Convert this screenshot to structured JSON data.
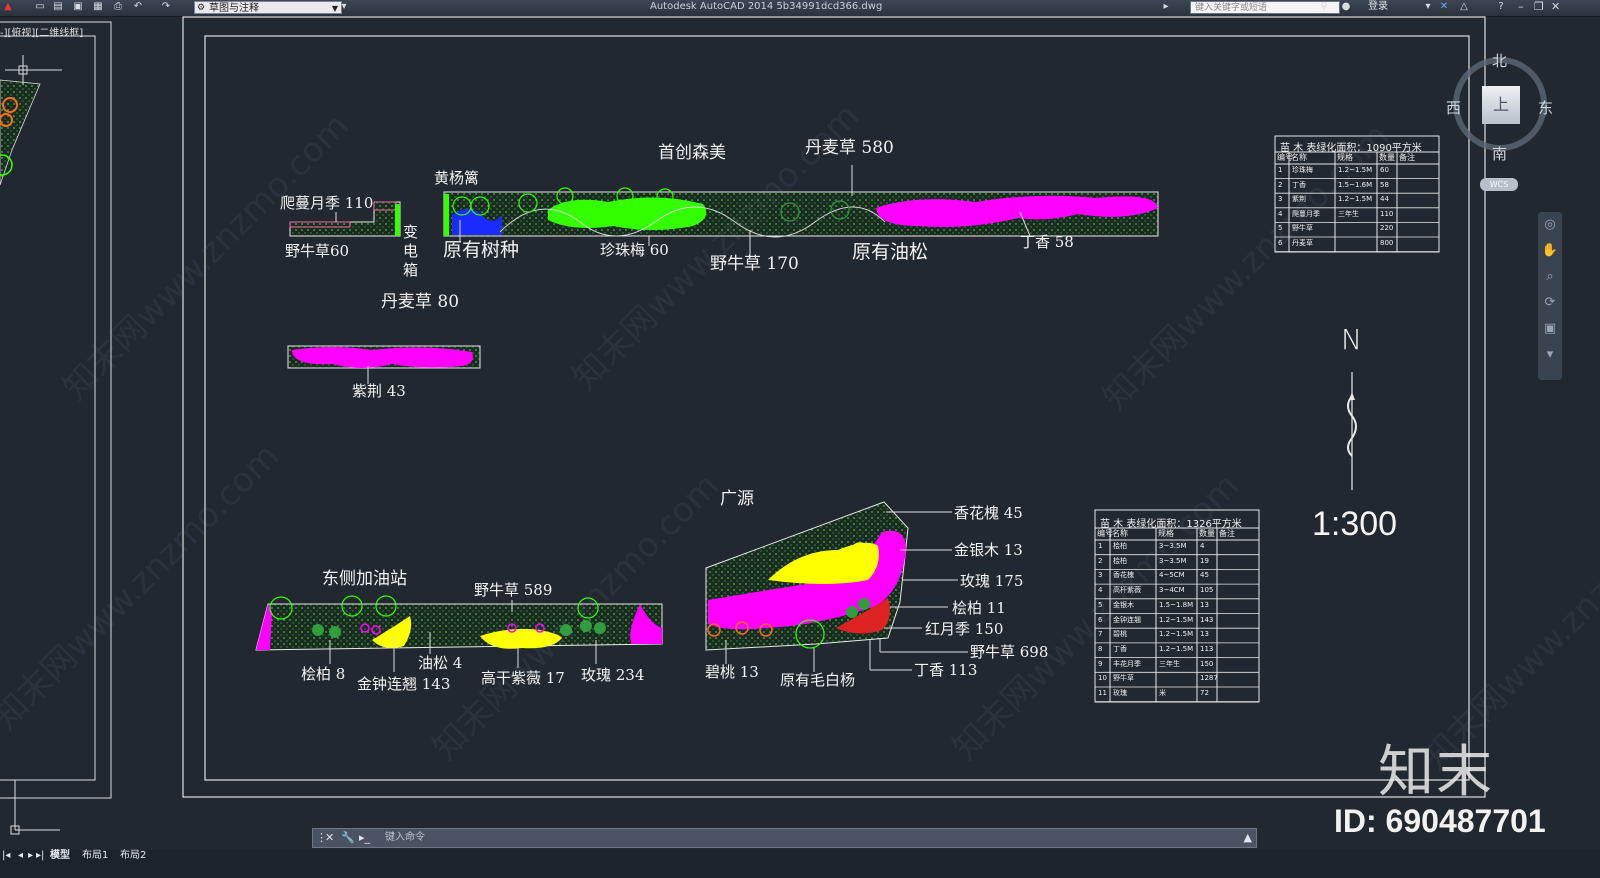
{
  "app": {
    "workspace": "草图与注释",
    "title": "Autodesk AutoCAD 2014    5b34991dcd366.dwg",
    "search_placeholder": "键入关键字或短语",
    "login": "登录"
  },
  "viewport": {
    "left_label": "-][俯视][二维线框]"
  },
  "viewcube": {
    "north": "北",
    "south": "南",
    "east": "东",
    "west": "西",
    "face": "上",
    "wcs": "WCS"
  },
  "drawing": {
    "north_arrow": "N",
    "scale": "1:300",
    "section1": {
      "title": "首创森美",
      "labels": {
        "pashan": "爬蔓月季  110",
        "yeniu60": "野牛草60",
        "biandian": "变电箱",
        "huangyang": "黄杨篱",
        "yuanyou_shuzhong": "原有树种",
        "zhenzhumei": "珍珠梅  60",
        "yeniu170": "野牛草  170",
        "yuanyou_yousong": "原有油松",
        "danmai580": "丹麦草  580",
        "dingxiang58": "丁香  58"
      }
    },
    "section2": {
      "danmai80": "丹麦草  80",
      "zijing43": "紫荆  43"
    },
    "section3": {
      "title": "东侧加油站",
      "labels": {
        "yeniu589": "野牛草  589",
        "guibai8": "桧柏  8",
        "jinzhong143": "金钟连翘  143",
        "yousong4": "油松  4",
        "gaogan17": "高干紫薇  17",
        "meigui234": "玫瑰  234"
      }
    },
    "section4": {
      "title": "广源",
      "labels": {
        "xianghuahuai45": "香花槐  45",
        "jinyinmu13": "金银木  13",
        "meigui175": "玫瑰  175",
        "guibai11": "桧柏  11",
        "hongyueji150": "红月季  150",
        "yeniu698": "野牛草  698",
        "dingxiang113": "丁香  113",
        "bitao13": "碧桃  13",
        "maobaiyang": "原有毛白杨"
      }
    },
    "table1": {
      "title": "苗  木  表绿化面积：1090平方米",
      "headers": [
        "编号",
        "名称",
        "规格",
        "数量",
        "备注"
      ],
      "rows": [
        [
          "1",
          "珍珠梅",
          "1.2~1.5M",
          "60",
          ""
        ],
        [
          "2",
          "丁香",
          "1.5~1.6M",
          "58",
          ""
        ],
        [
          "3",
          "紫荆",
          "1.2~1.5M",
          "44",
          ""
        ],
        [
          "4",
          "爬蔓月季",
          "三年生",
          "110",
          ""
        ],
        [
          "5",
          "野牛草",
          "",
          "220",
          ""
        ],
        [
          "6",
          "丹麦草",
          "",
          "800",
          ""
        ]
      ]
    },
    "table2": {
      "title": "苗  木  表绿化面积：1326平方米",
      "headers": [
        "编号",
        "名称",
        "规格",
        "数量",
        "备注"
      ],
      "rows": [
        [
          "1",
          "桧柏",
          "3~3.5M",
          "4",
          ""
        ],
        [
          "2",
          "桧柏",
          "3~3.5M",
          "19",
          ""
        ],
        [
          "3",
          "香花槐",
          "4~5CM",
          "45",
          ""
        ],
        [
          "4",
          "高杆紫薇",
          "3~4CM",
          "105",
          ""
        ],
        [
          "5",
          "金银木",
          "1.5~1.8M",
          "13",
          ""
        ],
        [
          "6",
          "金钟连翘",
          "1.2~1.5M",
          "143",
          ""
        ],
        [
          "7",
          "碧桃",
          "1.2~1.5M",
          "13",
          ""
        ],
        [
          "8",
          "丁香",
          "1.2~1.5M",
          "113",
          ""
        ],
        [
          "9",
          "丰花月季",
          "三年生",
          "150",
          ""
        ],
        [
          "10",
          "野牛草",
          "",
          "1287",
          ""
        ],
        [
          "11",
          "玫瑰",
          "米",
          "72",
          ""
        ]
      ]
    }
  },
  "command": {
    "placeholder": "键入命令"
  },
  "tabs": [
    "模型",
    "布局1",
    "布局2"
  ],
  "watermark": {
    "text": "知末网www.znzmo.com",
    "brand": "知末",
    "id": "ID: 690487701"
  },
  "colors": {
    "background": "#212830",
    "green_plant": "#33ff00",
    "magenta_plant": "#ff00ff",
    "yellow_plant": "#ffff00",
    "hatch": "#2fa84a",
    "outline": "#e8e8e8"
  }
}
